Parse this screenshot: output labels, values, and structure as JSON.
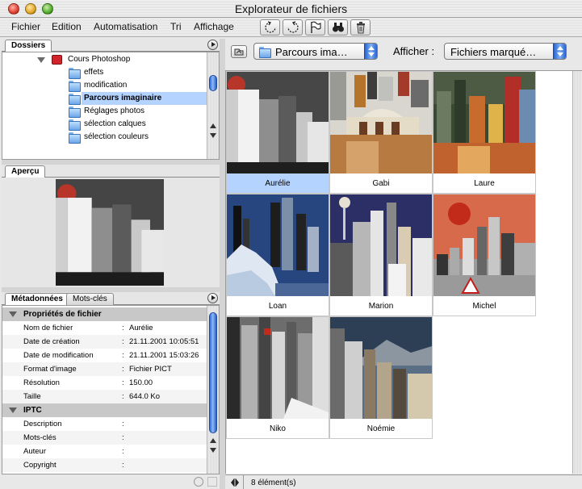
{
  "window": {
    "title": "Explorateur de fichiers"
  },
  "menu": [
    "Fichier",
    "Edition",
    "Automatisation",
    "Tri",
    "Affichage"
  ],
  "toolbar_icons": [
    "rotate-left-icon",
    "rotate-right-icon",
    "flag-icon",
    "binoculars-icon",
    "trash-icon"
  ],
  "folders_panel": {
    "tab": "Dossiers",
    "root": "Cours Photoshop",
    "items": [
      "effets",
      "modification",
      "Parcours imaginaire",
      "Réglages photos",
      "sélection calques",
      "sélection couleurs"
    ],
    "selected": "Parcours imaginaire"
  },
  "preview_panel": {
    "tab": "Aperçu"
  },
  "metadata_panel": {
    "tabs": [
      "Métadonnées",
      "Mots-clés"
    ],
    "sections": [
      {
        "title": "Propriétés de fichier",
        "rows": [
          {
            "key": "Nom de fichier",
            "value": "Aurélie"
          },
          {
            "key": "Date de création",
            "value": "21.11.2001 10:05:51"
          },
          {
            "key": "Date de modification",
            "value": "21.11.2001 15:03:26"
          },
          {
            "key": "Format d'image",
            "value": "Fichier PICT"
          },
          {
            "key": "Résolution",
            "value": "150.00"
          },
          {
            "key": "Taille",
            "value": "644.0 Ko"
          }
        ]
      },
      {
        "title": "IPTC",
        "rows": [
          {
            "key": "Description",
            "value": ""
          },
          {
            "key": "Mots-clés",
            "value": ""
          },
          {
            "key": "Auteur",
            "value": ""
          },
          {
            "key": "Copyright",
            "value": ""
          }
        ]
      }
    ]
  },
  "location_popup": {
    "value": "Parcours ima…"
  },
  "show_label": "Afficher :",
  "show_popup": {
    "value": "Fichiers marqué…"
  },
  "thumbnails": [
    "Aurélie",
    "Gabi",
    "Laure",
    "Loan",
    "Marion",
    "Michel",
    "Niko",
    "Noémie"
  ],
  "selected_thumbnail": "Aurélie",
  "status": {
    "count": "8 élément(s)"
  },
  "colors": {
    "selection": "#b5d3ff",
    "accent": "#2a63cf"
  }
}
